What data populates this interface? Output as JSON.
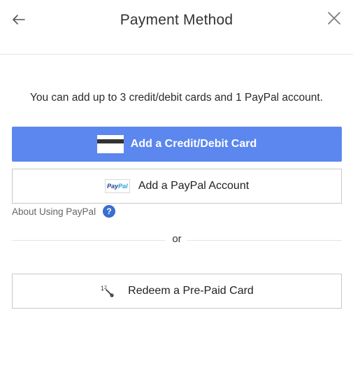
{
  "header": {
    "title": "Payment Method",
    "back_icon": "arrow-left-icon",
    "close_icon": "close-icon"
  },
  "info_text": "You can add up to 3 credit/debit cards and 1 PayPal account.",
  "buttons": {
    "add_card": {
      "label": "Add a Credit/Debit Card",
      "icon": "credit-card-icon",
      "background": "#5b87ef"
    },
    "add_paypal": {
      "label": "Add a PayPal Account",
      "icon": "paypal-logo-icon",
      "logo_text_1": "Pay",
      "logo_text_2": "Pal"
    },
    "redeem": {
      "label": "Redeem a Pre-Paid Card",
      "icon": "prepaid-card-icon"
    }
  },
  "about_paypal": {
    "label": "About Using PayPal",
    "help_icon": "question-icon",
    "help_glyph": "?"
  },
  "divider_text": "or",
  "colors": {
    "accent": "#5b87ef",
    "help": "#3a6fcf"
  }
}
